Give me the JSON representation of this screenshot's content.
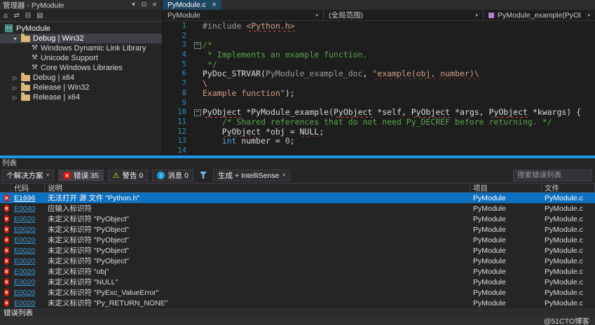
{
  "colors": {
    "accent": "#007acc",
    "splitter": "#1c97ea",
    "error": "#e51400",
    "warning": "#f2cb1d",
    "info": "#1ba1e2",
    "selection": "#0e70c0",
    "tab": "#1e4661",
    "string": "#d69d85",
    "comment": "#57a64a",
    "keyword": "#569cd6",
    "preproc": "#9b9b9b",
    "linenum": "#2b91af",
    "code_link": "#3d9bd6",
    "squiggle": "#f14c4c"
  },
  "icons": {
    "window_menu": "▾",
    "pin": "⊡",
    "close": "×",
    "dropdown": "▾",
    "home": "⌂",
    "sync": "⇄",
    "collapse_all": "⊟",
    "properties": "▤",
    "chevron_expanded": "▾",
    "chevron_collapsed": "▷",
    "wrench": "⚒",
    "fold_open": "−",
    "error_x": "×",
    "warning_glyph": "⚠",
    "info_glyph": "i"
  },
  "solution_explorer": {
    "title": "管理器 - PyModule",
    "root_label": "PyModule",
    "items": [
      {
        "label": "Debug | Win32",
        "kind": "folder",
        "expanded": true,
        "selected": true,
        "indent": 1
      },
      {
        "label": "Windows Dynamic Link Library",
        "kind": "wrench",
        "indent": 2
      },
      {
        "label": "Unicode Support",
        "kind": "wrench",
        "indent": 2
      },
      {
        "label": "Core Windows Libraries",
        "kind": "wrench",
        "indent": 2
      },
      {
        "label": "Debug | x64",
        "kind": "folder",
        "expanded": false,
        "indent": 1
      },
      {
        "label": "Release | Win32",
        "kind": "folder",
        "expanded": false,
        "indent": 1
      },
      {
        "label": "Release | x64",
        "kind": "folder",
        "expanded": false,
        "indent": 1
      }
    ]
  },
  "editor": {
    "tab_label": "PyModule.c",
    "nav_project": "PyModule",
    "nav_scope": "(全局范围)",
    "nav_member": "PyModule_example(PyObject *",
    "code_lines": [
      {
        "tokens": [
          [
            "#include ",
            "pp"
          ],
          [
            "<Python.h>",
            "str err"
          ]
        ]
      },
      {
        "tokens": []
      },
      {
        "fold": true,
        "tokens": [
          [
            "/*",
            "cmt"
          ]
        ]
      },
      {
        "tokens": [
          [
            " * Implements an example function.",
            "cmt"
          ]
        ]
      },
      {
        "tokens": [
          [
            " */",
            "cmt"
          ]
        ]
      },
      {
        "tokens": [
          [
            "PyDoc_STRVAR",
            "id"
          ],
          [
            "(",
            "id"
          ],
          [
            "PyModule_example_doc",
            "pp"
          ],
          [
            ", ",
            "id"
          ],
          [
            "\"example(obj, number)\\",
            "str err"
          ]
        ]
      },
      {
        "tokens": [
          [
            "\\",
            "str"
          ]
        ]
      },
      {
        "tokens": [
          [
            "Example function\"",
            "str"
          ],
          [
            ");",
            "id"
          ]
        ]
      },
      {
        "tokens": []
      },
      {
        "fold": true,
        "tokens": [
          [
            "PyObject",
            "id err"
          ],
          [
            " *",
            "id"
          ],
          [
            "PyModule_example",
            "id"
          ],
          [
            "(",
            "id"
          ],
          [
            "PyObject",
            "id err"
          ],
          [
            " *self, ",
            "id"
          ],
          [
            "PyObject",
            "id err"
          ],
          [
            " *args, ",
            "id"
          ],
          [
            "PyObject",
            "id err"
          ],
          [
            " *kwargs) {",
            "id"
          ]
        ]
      },
      {
        "tokens": [
          [
            "    /* Shared references that do not need Py_DECREF before returning. */",
            "cmt"
          ]
        ]
      },
      {
        "tokens": [
          [
            "    ",
            "id"
          ],
          [
            "PyObject",
            "id err"
          ],
          [
            " *obj = ",
            "id"
          ],
          [
            "NULL",
            "id err"
          ],
          [
            ";",
            "id"
          ]
        ]
      },
      {
        "tokens": [
          [
            "    ",
            "id"
          ],
          [
            "int",
            "kw"
          ],
          [
            " number = ",
            "id"
          ],
          [
            "0",
            "num"
          ],
          [
            ";",
            "id"
          ]
        ]
      },
      {
        "tokens": []
      }
    ]
  },
  "error_list": {
    "caption": "列表",
    "scope_dropdown": "个解决方案",
    "errors_button": "错误 35",
    "warnings_button": "警告 0",
    "messages_button": "消息 0",
    "source_dropdown": "生成 + IntelliSense",
    "search_placeholder": "搜索错误列表",
    "columns": {
      "code": "代码",
      "description": "说明",
      "project": "项目",
      "file": "文件"
    },
    "rows": [
      {
        "code": "E1696",
        "description": "无法打开 源 文件 \"Python.h\"",
        "project": "PyModule",
        "file": "PyModule.c",
        "selected": true
      },
      {
        "code": "E0040",
        "description": "应输入标识符",
        "project": "PyModule",
        "file": "PyModule.c"
      },
      {
        "code": "E0020",
        "description": "未定义标识符 \"PyObject\"",
        "project": "PyModule",
        "file": "PyModule.c"
      },
      {
        "code": "E0020",
        "description": "未定义标识符 \"PyObject\"",
        "project": "PyModule",
        "file": "PyModule.c"
      },
      {
        "code": "E0020",
        "description": "未定义标识符 \"PyObject\"",
        "project": "PyModule",
        "file": "PyModule.c"
      },
      {
        "code": "E0020",
        "description": "未定义标识符 \"PyObject\"",
        "project": "PyModule",
        "file": "PyModule.c"
      },
      {
        "code": "E0020",
        "description": "未定义标识符 \"PyObject\"",
        "project": "PyModule",
        "file": "PyModule.c"
      },
      {
        "code": "E0020",
        "description": "未定义标识符 \"obj\"",
        "project": "PyModule",
        "file": "PyModule.c"
      },
      {
        "code": "E0020",
        "description": "未定义标识符 \"NULL\"",
        "project": "PyModule",
        "file": "PyModule.c"
      },
      {
        "code": "E0020",
        "description": "未定义标识符 \"PyExc_ValueError\"",
        "project": "PyModule",
        "file": "PyModule.c"
      },
      {
        "code": "E0020",
        "description": "未定义标识符 \"Py_RETURN_NONE\"",
        "project": "PyModule",
        "file": "PyModule.c"
      }
    ]
  },
  "bottom": {
    "dock_tab": "错误列表",
    "watermark": "@51CTO博客"
  }
}
